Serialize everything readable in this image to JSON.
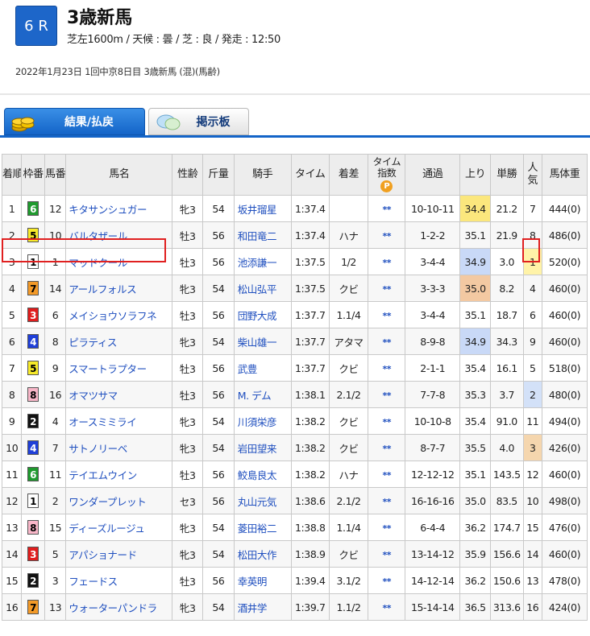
{
  "race": {
    "number": "6 R",
    "title": "3歳新馬",
    "conditions": "芝左1600m / 天候 : 曇 / 芝 : 良 / 発走 : 12:50",
    "info": "2022年1月23日 1回中京8日目 3歳新馬 (混)(馬齢)"
  },
  "tabs": [
    {
      "label": "結果/払戻",
      "icon": "coins-icon"
    },
    {
      "label": "掲示板",
      "icon": "speech-bubble-icon"
    }
  ],
  "columns": {
    "rank": "着順",
    "waku": "枠番",
    "num": "馬番",
    "name": "馬名",
    "sexage": "性齢",
    "weight": "斤量",
    "jockey": "騎手",
    "time": "タイム",
    "margin": "着差",
    "index": "タイム指数",
    "passing": "通過",
    "last3f": "上り",
    "odds": "単勝",
    "pop": "人気",
    "body": "馬体重",
    "index_badge": "P"
  },
  "rows": [
    {
      "rank": "1",
      "waku": "6",
      "num": "12",
      "name": "キタサンシュガー",
      "sexage": "牝3",
      "weight": "54",
      "jockey": "坂井瑠星",
      "time": "1:37.4",
      "margin": "",
      "index": "**",
      "passing": "10-10-11",
      "last3f": "34.4",
      "odds": "21.2",
      "pop": "7",
      "body": "444(0)"
    },
    {
      "rank": "2",
      "waku": "5",
      "num": "10",
      "name": "バルタザール",
      "sexage": "牡3",
      "weight": "56",
      "jockey": "和田竜二",
      "time": "1:37.4",
      "margin": "ハナ",
      "index": "**",
      "passing": "1-2-2",
      "last3f": "35.1",
      "odds": "21.9",
      "pop": "8",
      "body": "486(0)"
    },
    {
      "rank": "3",
      "waku": "1",
      "num": "1",
      "name": "マッドクール",
      "sexage": "牡3",
      "weight": "56",
      "jockey": "池添謙一",
      "time": "1:37.5",
      "margin": "1/2",
      "index": "**",
      "passing": "3-4-4",
      "last3f": "34.9",
      "odds": "3.0",
      "pop": "1",
      "body": "520(0)"
    },
    {
      "rank": "4",
      "waku": "7",
      "num": "14",
      "name": "アールフォルス",
      "sexage": "牝3",
      "weight": "54",
      "jockey": "松山弘平",
      "time": "1:37.5",
      "margin": "クビ",
      "index": "**",
      "passing": "3-3-3",
      "last3f": "35.0",
      "odds": "8.2",
      "pop": "4",
      "body": "460(0)"
    },
    {
      "rank": "5",
      "waku": "3",
      "num": "6",
      "name": "メイショウソラフネ",
      "sexage": "牡3",
      "weight": "56",
      "jockey": "団野大成",
      "time": "1:37.7",
      "margin": "1.1/4",
      "index": "**",
      "passing": "3-4-4",
      "last3f": "35.1",
      "odds": "18.7",
      "pop": "6",
      "body": "460(0)"
    },
    {
      "rank": "6",
      "waku": "4",
      "num": "8",
      "name": "ピラティス",
      "sexage": "牝3",
      "weight": "54",
      "jockey": "柴山雄一",
      "time": "1:37.7",
      "margin": "アタマ",
      "index": "**",
      "passing": "8-9-8",
      "last3f": "34.9",
      "odds": "34.3",
      "pop": "9",
      "body": "460(0)"
    },
    {
      "rank": "7",
      "waku": "5",
      "num": "9",
      "name": "スマートラプター",
      "sexage": "牡3",
      "weight": "56",
      "jockey": "武豊",
      "time": "1:37.7",
      "margin": "クビ",
      "index": "**",
      "passing": "2-1-1",
      "last3f": "35.4",
      "odds": "16.1",
      "pop": "5",
      "body": "518(0)"
    },
    {
      "rank": "8",
      "waku": "8",
      "num": "16",
      "name": "オマツサマ",
      "sexage": "牡3",
      "weight": "56",
      "jockey": "M. デム",
      "time": "1:38.1",
      "margin": "2.1/2",
      "index": "**",
      "passing": "7-7-8",
      "last3f": "35.3",
      "odds": "3.7",
      "pop": "2",
      "body": "480(0)"
    },
    {
      "rank": "9",
      "waku": "2",
      "num": "4",
      "name": "オースミミライ",
      "sexage": "牝3",
      "weight": "54",
      "jockey": "川須栄彦",
      "time": "1:38.2",
      "margin": "クビ",
      "index": "**",
      "passing": "10-10-8",
      "last3f": "35.4",
      "odds": "91.0",
      "pop": "11",
      "body": "494(0)"
    },
    {
      "rank": "10",
      "waku": "4",
      "num": "7",
      "name": "サトノリーベ",
      "sexage": "牝3",
      "weight": "54",
      "jockey": "岩田望来",
      "time": "1:38.2",
      "margin": "クビ",
      "index": "**",
      "passing": "8-7-7",
      "last3f": "35.5",
      "odds": "4.0",
      "pop": "3",
      "body": "426(0)"
    },
    {
      "rank": "11",
      "waku": "6",
      "num": "11",
      "name": "テイエムウイン",
      "sexage": "牡3",
      "weight": "56",
      "jockey": "鮫島良太",
      "time": "1:38.2",
      "margin": "ハナ",
      "index": "**",
      "passing": "12-12-12",
      "last3f": "35.1",
      "odds": "143.5",
      "pop": "12",
      "body": "460(0)"
    },
    {
      "rank": "12",
      "waku": "1",
      "num": "2",
      "name": "ワンダープレット",
      "sexage": "セ3",
      "weight": "56",
      "jockey": "丸山元気",
      "time": "1:38.6",
      "margin": "2.1/2",
      "index": "**",
      "passing": "16-16-16",
      "last3f": "35.0",
      "odds": "83.5",
      "pop": "10",
      "body": "498(0)"
    },
    {
      "rank": "13",
      "waku": "8",
      "num": "15",
      "name": "ディーズルージュ",
      "sexage": "牝3",
      "weight": "54",
      "jockey": "菱田裕二",
      "time": "1:38.8",
      "margin": "1.1/4",
      "index": "**",
      "passing": "6-4-4",
      "last3f": "36.2",
      "odds": "174.7",
      "pop": "15",
      "body": "476(0)"
    },
    {
      "rank": "14",
      "waku": "3",
      "num": "5",
      "name": "アパショナード",
      "sexage": "牝3",
      "weight": "54",
      "jockey": "松田大作",
      "time": "1:38.9",
      "margin": "クビ",
      "index": "**",
      "passing": "13-14-12",
      "last3f": "35.9",
      "odds": "156.6",
      "pop": "14",
      "body": "460(0)"
    },
    {
      "rank": "15",
      "waku": "2",
      "num": "3",
      "name": "フェードス",
      "sexage": "牡3",
      "weight": "56",
      "jockey": "幸英明",
      "time": "1:39.4",
      "margin": "3.1/2",
      "index": "**",
      "passing": "14-12-14",
      "last3f": "36.2",
      "odds": "150.6",
      "pop": "13",
      "body": "478(0)"
    },
    {
      "rank": "16",
      "waku": "7",
      "num": "13",
      "name": "ウォーターパンドラ",
      "sexage": "牝3",
      "weight": "54",
      "jockey": "酒井学",
      "time": "1:39.7",
      "margin": "1.1/2",
      "index": "**",
      "passing": "15-14-14",
      "last3f": "36.5",
      "odds": "313.6",
      "pop": "16",
      "body": "424(0)"
    }
  ],
  "highlights": {
    "last3f_top": [
      "yellow",
      "",
      "blue",
      "orange",
      "",
      "blue",
      "",
      "",
      "",
      "",
      "",
      "",
      "",
      "",
      "",
      ""
    ],
    "pop_top": [
      "",
      "",
      "yellow",
      "",
      "",
      "",
      "",
      "blue",
      "",
      "orange",
      "",
      "",
      "",
      "",
      "",
      ""
    ]
  },
  "colors": {
    "accent": "#1364c8",
    "highlight_border": "#e02020",
    "waku": {
      "1": "#ffffff",
      "2": "#111111",
      "3": "#e01d1d",
      "4": "#1f3fd8",
      "5": "#f7ea2a",
      "6": "#1f9a2e",
      "7": "#f39a28",
      "8": "#f8b6c8"
    }
  }
}
